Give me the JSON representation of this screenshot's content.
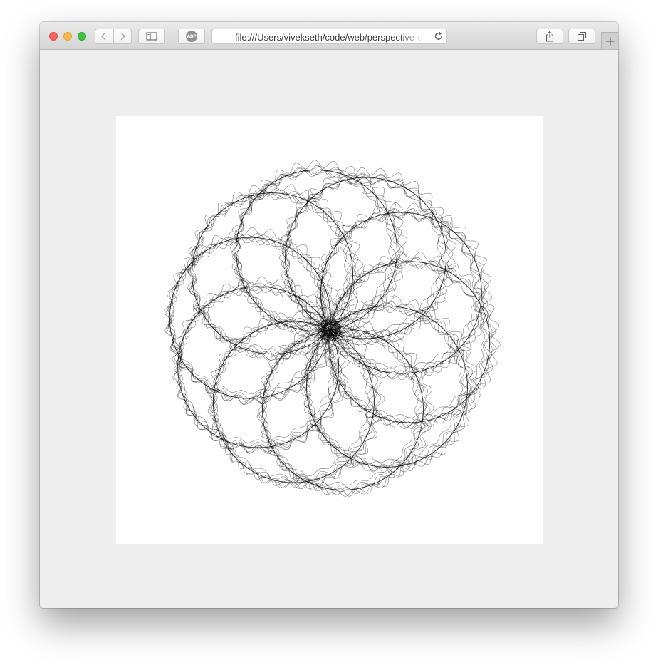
{
  "browser": {
    "address_bar": {
      "url": "file:///Users/vivekseth/code/web/perspective-c"
    },
    "adblock_badge": "ABP",
    "icons": {
      "back": "chevron-left-icon",
      "forward": "chevron-right-icon",
      "sidebar": "sidebar-icon",
      "adblock": "adblock-plus-icon",
      "reload": "reload-icon",
      "share": "share-icon",
      "tabs": "tab-overview-icon",
      "new_tab": "plus-icon"
    },
    "colors": {
      "close": "#fc605c",
      "minimize": "#fdbc40",
      "maximize": "#34c84a",
      "page_background": "#eeeeee",
      "canvas_background": "#ffffff",
      "stroke": "#000000"
    }
  },
  "page": {
    "canvas": {
      "background": "#ffffff",
      "drawing": "rosette-spirograph"
    }
  }
}
